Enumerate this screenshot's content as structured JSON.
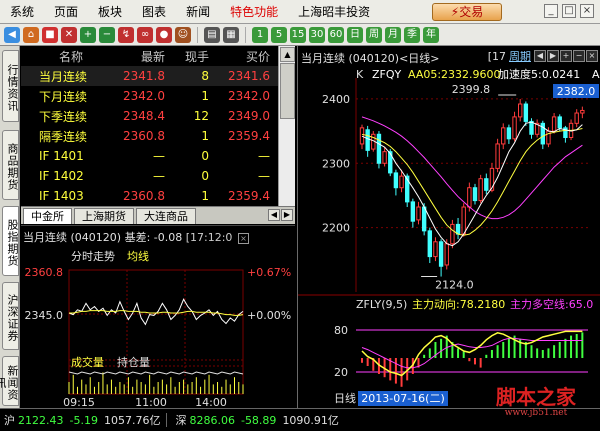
{
  "menu": {
    "items": [
      "系统",
      "页面",
      "板块",
      "图表",
      "新闻",
      "特色功能",
      "上海昭丰投资"
    ],
    "trade_label": "⚡交易",
    "win_buttons": [
      "_",
      "□",
      "×"
    ]
  },
  "toolbar": {
    "icons": [
      {
        "name": "back-icon",
        "glyph": "◀",
        "color": "#3a8ee0"
      },
      {
        "name": "home-icon",
        "glyph": "⌂",
        "color": "#d06a20"
      },
      {
        "name": "quote-icon",
        "glyph": "■",
        "color": "#d03030"
      },
      {
        "name": "news-icon",
        "glyph": "✕",
        "color": "#c03030"
      },
      {
        "name": "zoom-in-icon",
        "glyph": "+",
        "color": "#2a8a3a"
      },
      {
        "name": "zoom-out-icon",
        "glyph": "−",
        "color": "#2a8a3a"
      },
      {
        "name": "ranking-icon",
        "glyph": "↯",
        "color": "#c03030"
      },
      {
        "name": "link-icon",
        "glyph": "∞",
        "color": "#c03030"
      },
      {
        "name": "search-icon",
        "glyph": "●",
        "color": "#c03030"
      },
      {
        "name": "user-icon",
        "glyph": "☺",
        "color": "#a05020"
      },
      {
        "name": "layout-icon",
        "glyph": "▤",
        "color": "#555"
      },
      {
        "name": "grid-icon",
        "glyph": "▦",
        "color": "#555"
      },
      {
        "name": "period-1-icon",
        "glyph": "1",
        "color": "#3a9a3a"
      },
      {
        "name": "period-5-icon",
        "glyph": "5",
        "color": "#3a9a3a"
      },
      {
        "name": "period-15-icon",
        "glyph": "15",
        "color": "#3a9a3a"
      },
      {
        "name": "period-30-icon",
        "glyph": "30",
        "color": "#3a9a3a"
      },
      {
        "name": "period-60-icon",
        "glyph": "60",
        "color": "#3a9a3a"
      },
      {
        "name": "day-icon",
        "glyph": "日",
        "color": "#3a9a3a"
      },
      {
        "name": "week-icon",
        "glyph": "周",
        "color": "#3a9a3a"
      },
      {
        "name": "month-icon",
        "glyph": "月",
        "color": "#3a9a3a"
      },
      {
        "name": "season-icon",
        "glyph": "季",
        "color": "#3a9a3a"
      },
      {
        "name": "year-icon",
        "glyph": "年",
        "color": "#3a9a3a"
      }
    ]
  },
  "sidetabs": [
    "行情资讯",
    "商品期货",
    "股指期货",
    "沪深证券",
    "新闻资讯"
  ],
  "quotes": {
    "headers": [
      "名称",
      "最新",
      "现手",
      "买价"
    ],
    "rows": [
      {
        "name": "当月连续",
        "last": "2341.8",
        "vol": "8",
        "bid": "2341.6"
      },
      {
        "name": "下月连续",
        "last": "2342.0",
        "vol": "1",
        "bid": "2342.0"
      },
      {
        "name": "下季连续",
        "last": "2348.4",
        "vol": "12",
        "bid": "2349.0"
      },
      {
        "name": "隔季连续",
        "last": "2360.8",
        "vol": "1",
        "bid": "2359.4"
      },
      {
        "name": "IF  1401",
        "last": "—",
        "vol": "0",
        "bid": "—"
      },
      {
        "name": "IF  1402",
        "last": "—",
        "vol": "0",
        "bid": "—"
      },
      {
        "name": "IF  1403",
        "last": "2360.8",
        "vol": "1",
        "bid": "2359.4"
      }
    ]
  },
  "subtabs": [
    "中金所",
    "上海期货",
    "大连商品"
  ],
  "tick": {
    "title": "当月连续 (040120) 基差: -0.08",
    "corner": "[17:12:0",
    "label_trend": "分时走势",
    "label_ma": "均线",
    "price_high": "2360.8",
    "price_mid": "2345.0",
    "pct_high": "+0.67%",
    "pct_mid": "+0.00%",
    "label_volume": "成交量",
    "label_oi": "持仓量",
    "times": [
      "09:15",
      "11:00",
      "14:00"
    ],
    "line": [
      0.58,
      0.56,
      0.62,
      0.6,
      0.7,
      0.62,
      0.66,
      0.6,
      0.64,
      0.55,
      0.62,
      0.58,
      0.72,
      0.6,
      0.5,
      0.58,
      0.7,
      0.52,
      0.44,
      0.56,
      0.55,
      0.6,
      0.7,
      0.62,
      0.5,
      0.55,
      0.62,
      0.75,
      0.66,
      0.6,
      0.5,
      0.55,
      0.58,
      0.62,
      0.55,
      0.6,
      0.5,
      0.45,
      0.52,
      0.48,
      0.56,
      0.6
    ],
    "ma": [
      0.58,
      0.58,
      0.59,
      0.6,
      0.6,
      0.61,
      0.61,
      0.61,
      0.61,
      0.6,
      0.6,
      0.6,
      0.61,
      0.61,
      0.6,
      0.6,
      0.6,
      0.59,
      0.59,
      0.58,
      0.58,
      0.58,
      0.59,
      0.59,
      0.58,
      0.58,
      0.58,
      0.59,
      0.6,
      0.6,
      0.59,
      0.59,
      0.59,
      0.59,
      0.58,
      0.58,
      0.57,
      0.56,
      0.56,
      0.55,
      0.55,
      0.56
    ],
    "vols": [
      0.5,
      0.8,
      0.3,
      0.6,
      0.4,
      0.7,
      0.3,
      0.5,
      0.9,
      0.4,
      0.6,
      0.3,
      0.5,
      0.4,
      0.7,
      0.3,
      0.6,
      0.5,
      0.4,
      0.8,
      0.3,
      0.5,
      0.6,
      0.4,
      0.7,
      0.3,
      0.5,
      0.6,
      0.4,
      0.5,
      0.7,
      0.3,
      0.6,
      0.8,
      0.4,
      0.5,
      0.3,
      0.6,
      0.4,
      0.7,
      0.5,
      0.4
    ]
  },
  "kline": {
    "title": "当月连续 (040120)<日线>",
    "corner": "[17",
    "period_label": "周期",
    "info_k": "K",
    "info_code": "ZFQY",
    "info_ma": "AA05:2332.9600",
    "info_speed": "加速度5:0.0241",
    "info_a": "A",
    "y_labels": [
      "2400",
      "2300",
      "2200"
    ],
    "price_tag": "2382.0",
    "high_label": "2399.8",
    "low_label": "2124.0",
    "ind_title": "ZFLY(9,5)",
    "ind_a": "主力动向:78.2180",
    "ind_b": "主力多空线:65.0",
    "ind_y": [
      "80",
      "20"
    ],
    "x_label": "日线",
    "date_label": "2013-07-16(二)",
    "candles": [
      [
        2330,
        2355,
        2322,
        2360
      ],
      [
        2352,
        2320,
        2310,
        2358
      ],
      [
        2322,
        2345,
        2318,
        2350
      ],
      [
        2345,
        2300,
        2292,
        2350
      ],
      [
        2300,
        2318,
        2295,
        2325
      ],
      [
        2318,
        2285,
        2280,
        2322
      ],
      [
        2285,
        2262,
        2250,
        2290
      ],
      [
        2262,
        2280,
        2255,
        2290
      ],
      [
        2280,
        2240,
        2232,
        2284
      ],
      [
        2240,
        2210,
        2200,
        2245
      ],
      [
        2212,
        2232,
        2205,
        2240
      ],
      [
        2232,
        2195,
        2188,
        2238
      ],
      [
        2195,
        2155,
        2145,
        2200
      ],
      [
        2155,
        2178,
        2148,
        2185
      ],
      [
        2178,
        2140,
        2124,
        2182
      ],
      [
        2142,
        2175,
        2135,
        2182
      ],
      [
        2175,
        2205,
        2168,
        2212
      ],
      [
        2205,
        2190,
        2182,
        2215
      ],
      [
        2190,
        2232,
        2186,
        2238
      ],
      [
        2232,
        2262,
        2225,
        2270
      ],
      [
        2262,
        2242,
        2236,
        2268
      ],
      [
        2242,
        2276,
        2238,
        2282
      ],
      [
        2276,
        2258,
        2252,
        2284
      ],
      [
        2258,
        2292,
        2255,
        2300
      ],
      [
        2292,
        2330,
        2286,
        2338
      ],
      [
        2330,
        2355,
        2322,
        2362
      ],
      [
        2355,
        2338,
        2330,
        2360
      ],
      [
        2338,
        2372,
        2334,
        2380
      ],
      [
        2372,
        2392,
        2365,
        2399.8
      ],
      [
        2392,
        2365,
        2358,
        2396
      ],
      [
        2365,
        2345,
        2338,
        2370
      ],
      [
        2345,
        2362,
        2340,
        2368
      ],
      [
        2362,
        2330,
        2322,
        2366
      ],
      [
        2330,
        2350,
        2325,
        2356
      ],
      [
        2350,
        2372,
        2346,
        2378
      ],
      [
        2372,
        2355,
        2350,
        2376
      ],
      [
        2355,
        2340,
        2332,
        2358
      ],
      [
        2340,
        2362,
        2336,
        2368
      ],
      [
        2362,
        2378,
        2356,
        2384
      ],
      [
        2378,
        2382,
        2370,
        2388
      ]
    ],
    "ma5": [
      2342,
      2338,
      2335,
      2330,
      2325,
      2315,
      2300,
      2288,
      2275,
      2262,
      2248,
      2232,
      2215,
      2198,
      2185,
      2175,
      2172,
      2178,
      2190,
      2205,
      2220,
      2236,
      2250,
      2262,
      2278,
      2298,
      2318,
      2332,
      2350,
      2362,
      2364,
      2360,
      2356,
      2350,
      2349,
      2354,
      2352,
      2350,
      2352,
      2360
    ],
    "ma10": [
      2345,
      2343,
      2340,
      2336,
      2332,
      2326,
      2318,
      2308,
      2298,
      2286,
      2272,
      2258,
      2244,
      2230,
      2216,
      2204,
      2196,
      2190,
      2188,
      2190,
      2196,
      2204,
      2214,
      2226,
      2240,
      2256,
      2272,
      2288,
      2304,
      2318,
      2328,
      2336,
      2342,
      2346,
      2348,
      2350,
      2351,
      2351,
      2352,
      2354
    ],
    "ma20": [
      2372,
      2369,
      2366,
      2362,
      2358,
      2353,
      2348,
      2342,
      2335,
      2327,
      2318,
      2309,
      2299,
      2289,
      2279,
      2268,
      2258,
      2248,
      2240,
      2232,
      2225,
      2220,
      2216,
      2214,
      2214,
      2216,
      2220,
      2226,
      2234,
      2244,
      2254,
      2264,
      2274,
      2284,
      2294,
      2302,
      2310,
      2316,
      2322,
      2328
    ],
    "ind_line": [
      50,
      42,
      38,
      30,
      25,
      20,
      18,
      15,
      22,
      30,
      45,
      55,
      62,
      70,
      72,
      68,
      60,
      55,
      50,
      48,
      52,
      58,
      66,
      72,
      76,
      74,
      70,
      66,
      62,
      60,
      62,
      66,
      70,
      72,
      74,
      76,
      78,
      78,
      78,
      78
    ],
    "ind_ref": [
      55,
      52,
      48,
      44,
      40,
      36,
      32,
      28,
      26,
      26,
      28,
      32,
      38,
      44,
      50,
      55,
      58,
      60,
      58,
      56,
      55,
      55,
      56,
      58,
      62,
      66,
      68,
      68,
      67,
      66,
      65,
      65,
      65,
      65,
      65,
      65,
      65,
      65,
      65,
      65
    ],
    "bars": [
      -3,
      -5,
      -8,
      -10,
      -12,
      -14,
      -16,
      -18,
      -14,
      -10,
      -6,
      2,
      6,
      10,
      12,
      14,
      10,
      6,
      4,
      -2,
      -4,
      -6,
      2,
      5,
      8,
      10,
      12,
      14,
      12,
      10,
      8,
      6,
      5,
      6,
      8,
      10,
      12,
      14,
      15,
      16
    ]
  },
  "status": {
    "sh_label": "沪",
    "sh_index": "2122.43",
    "sh_change": "-5.19",
    "sh_amount": "1057.76亿",
    "sz_label": "深",
    "sz_index": "8286.06",
    "sz_change": "-58.89",
    "sz_amount": "1090.91亿"
  },
  "watermark": {
    "title": "脚本之家",
    "url": "www.jb51.net"
  },
  "colors": {
    "up": "#ff3c3c",
    "down": "#40ffff",
    "ma5": "#ffffff",
    "ma10": "#ffff40",
    "ma20": "#ff40ff",
    "grid": "#7a0000"
  }
}
